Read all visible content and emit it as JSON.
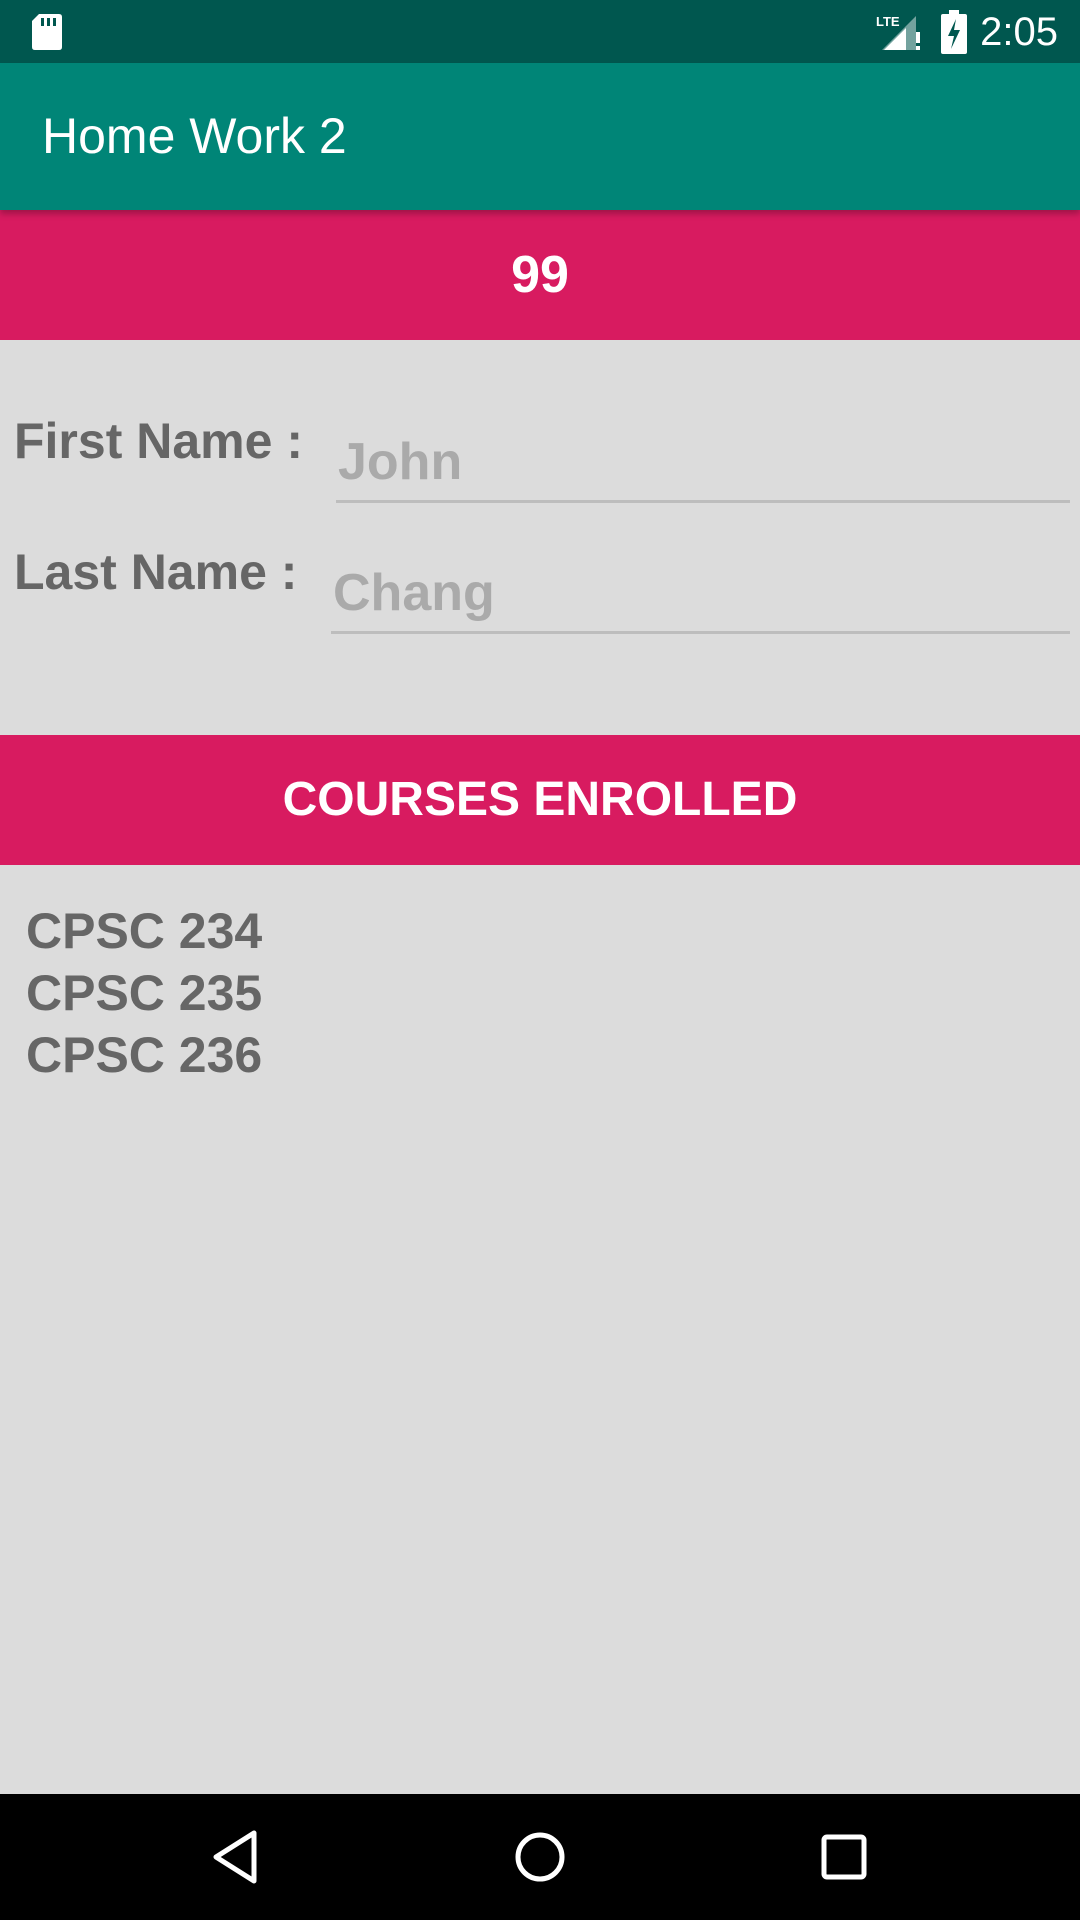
{
  "status_bar": {
    "time": "2:05",
    "icons": [
      "sd-card-icon",
      "lte-signal-icon",
      "battery-charging-icon"
    ],
    "network_label": "LTE"
  },
  "app_bar": {
    "title": "Home Work 2",
    "color": "#008577"
  },
  "score_banner": {
    "value": "99",
    "color": "#D81B60"
  },
  "form": {
    "first_name": {
      "label": "First Name :",
      "value": "John"
    },
    "last_name": {
      "label": "Last Name :",
      "value": "Chang"
    }
  },
  "courses": {
    "header": "COURSES ENROLLED",
    "items": [
      "CPSC 234",
      "CPSC 235",
      "CPSC 236"
    ]
  },
  "nav_bar": {
    "buttons": [
      "back-icon",
      "home-icon",
      "recents-icon"
    ]
  }
}
